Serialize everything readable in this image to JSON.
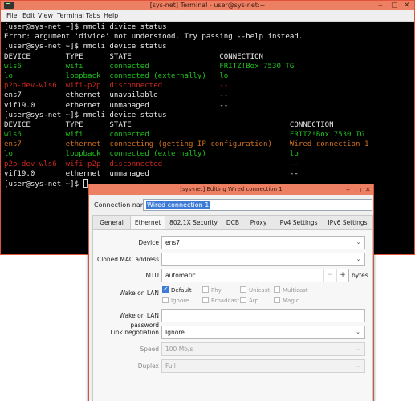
{
  "terminal": {
    "title": "[sys-net] Terminal - user@sys-net:~",
    "menu": [
      "File",
      "Edit",
      "View",
      "Terminal",
      "Tabs",
      "Help"
    ],
    "lines": [
      {
        "segs": [
          {
            "t": "[user@sys-net ~]$ nmcli divice status",
            "c": "white"
          }
        ]
      },
      {
        "segs": [
          {
            "t": "Error: argument 'divice' not understood. Try passing --help instead.",
            "c": "white"
          }
        ]
      },
      {
        "segs": [
          {
            "t": "[user@sys-net ~]$ nmcli device status",
            "c": "white"
          }
        ]
      },
      {
        "segs": [
          {
            "t": "DEVICE        TYPE      STATE                    CONNECTION",
            "c": "white"
          }
        ]
      },
      {
        "segs": [
          {
            "t": "wls6          wifi      connected                FRITZ!Box 7530 TG",
            "c": "green"
          }
        ]
      },
      {
        "segs": [
          {
            "t": "lo            loopback  connected (externally)   lo",
            "c": "green"
          }
        ]
      },
      {
        "segs": [
          {
            "t": "p2p-dev-wls6  wifi-p2p  disconnected             --",
            "c": "red"
          }
        ]
      },
      {
        "segs": [
          {
            "t": "ens7          ethernet  unavailable              --",
            "c": "white"
          }
        ]
      },
      {
        "segs": [
          {
            "t": "vif19.0       ethernet  unmanaged                --",
            "c": "white"
          }
        ]
      },
      {
        "segs": [
          {
            "t": "[user@sys-net ~]$ nmcli device status",
            "c": "white"
          }
        ]
      },
      {
        "segs": [
          {
            "t": "DEVICE        TYPE      STATE                                    CONNECTION",
            "c": "white"
          }
        ]
      },
      {
        "segs": [
          {
            "t": "wls6          wifi      connected                                FRITZ!Box 7530 TG",
            "c": "green"
          }
        ]
      },
      {
        "segs": [
          {
            "t": "ens7          ethernet  connecting (getting IP configuration)    Wired connection 1",
            "c": "orange"
          }
        ]
      },
      {
        "segs": [
          {
            "t": "lo            loopback  connected (externally)                   lo",
            "c": "green"
          }
        ]
      },
      {
        "segs": [
          {
            "t": "p2p-dev-wls6  wifi-p2p  disconnected                             --",
            "c": "red"
          }
        ]
      },
      {
        "segs": [
          {
            "t": "vif19.0       ethernet  unmanaged                                --",
            "c": "white"
          }
        ]
      },
      {
        "segs": [
          {
            "t": "[user@sys-net ~]$ ",
            "c": "white"
          }
        ],
        "cursor": true
      }
    ]
  },
  "dialog": {
    "title": "[sys-net] Editing Wired connection 1",
    "connection_name_label": "Connection name",
    "connection_name_value": "Wired connection 1",
    "tabs": [
      "General",
      "Ethernet",
      "802.1X Security",
      "DCB",
      "Proxy",
      "IPv4 Settings",
      "IPv6 Settings"
    ],
    "active_tab": "Ethernet",
    "device_label": "Device",
    "device_value": "ens7",
    "cloned_mac_label": "Cloned MAC address",
    "cloned_mac_value": "",
    "mtu_label": "MTU",
    "mtu_value": "automatic",
    "mtu_minus": "−",
    "mtu_plus": "+",
    "mtu_unit": "bytes",
    "wol_label": "Wake on LAN",
    "wol_options": [
      {
        "label": "Default",
        "checked": true
      },
      {
        "label": "Phy",
        "checked": false
      },
      {
        "label": "Unicast",
        "checked": false
      },
      {
        "label": "Multicast",
        "checked": false
      },
      {
        "label": "Ignore",
        "checked": false
      },
      {
        "label": "Broadcast",
        "checked": false
      },
      {
        "label": "Arp",
        "checked": false
      },
      {
        "label": "Magic",
        "checked": false
      }
    ],
    "wol_password_label": "Wake on LAN password",
    "wol_password_value": "",
    "link_negotiation_label": "Link negotiation",
    "link_negotiation_value": "Ignore",
    "speed_label": "Speed",
    "speed_value": "100 Mb/s",
    "duplex_label": "Duplex",
    "duplex_value": "Full"
  }
}
